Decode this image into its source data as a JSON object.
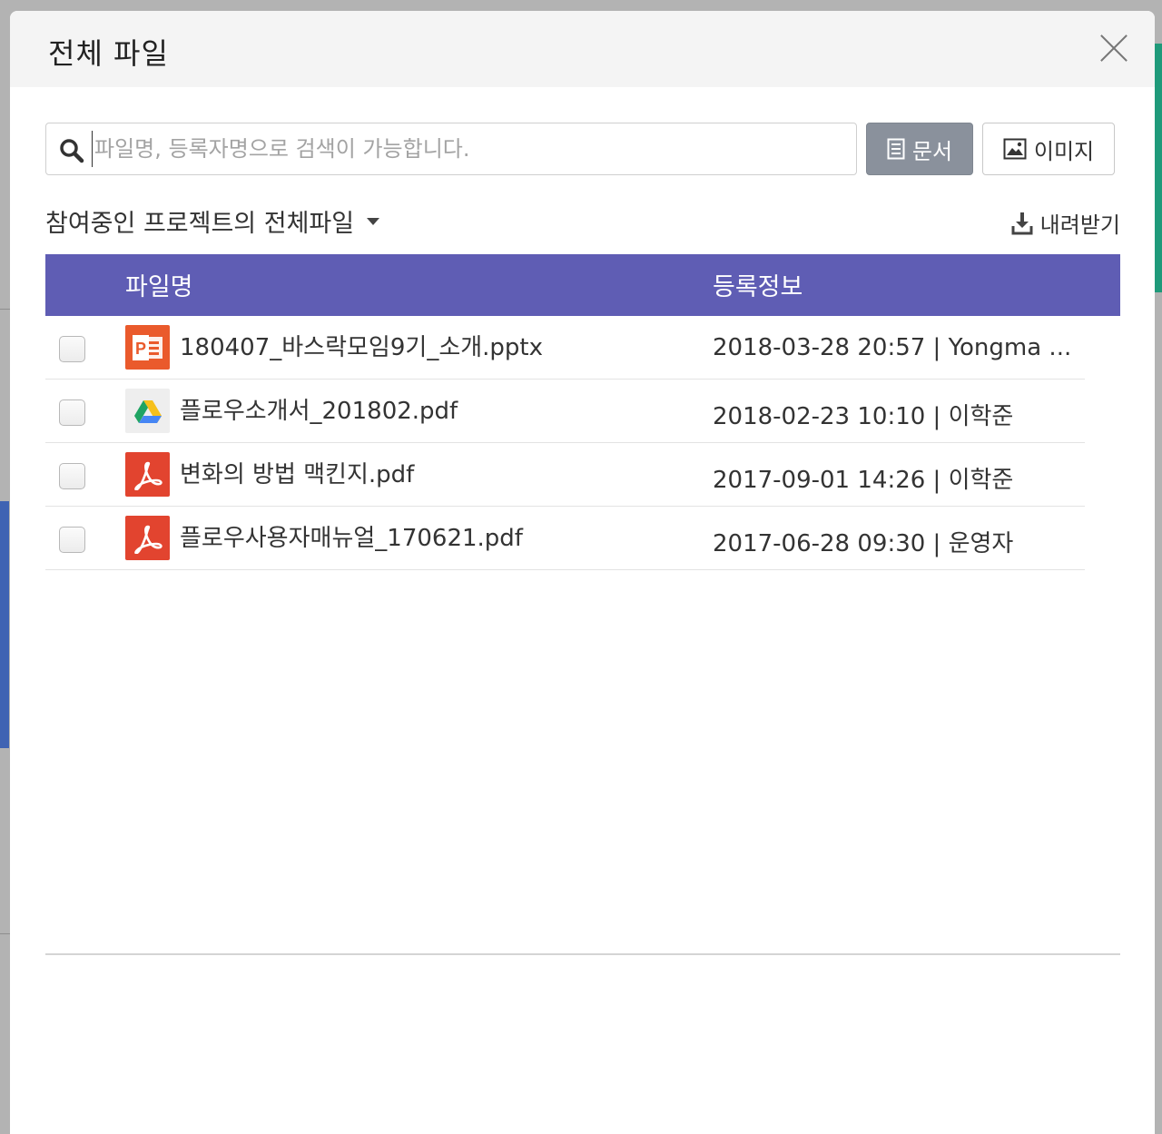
{
  "modal": {
    "title": "전체 파일"
  },
  "search": {
    "placeholder": "파일명, 등록자명으로 검색이 가능합니다.",
    "doc_button": "문서",
    "image_button": "이미지"
  },
  "filter": {
    "label": "참여중인 프로젝트의 전체파일",
    "download_label": "내려받기"
  },
  "table": {
    "headers": {
      "name": "파일명",
      "info": "등록정보"
    },
    "rows": [
      {
        "icon": "powerpoint-icon",
        "icon_color": "#ea5a2c",
        "name": "180407_바스락모임9기_소개.pptx",
        "info": "2018-03-28 20:57 | Yongma ..."
      },
      {
        "icon": "google-drive-icon",
        "icon_color": "#eeeeee",
        "name": "플로우소개서_201802.pdf",
        "info": "2018-02-23 10:10 | 이학준"
      },
      {
        "icon": "acrobat-pdf-icon",
        "icon_color": "#e2442f",
        "name": "변화의 방법 맥킨지.pdf",
        "info": "2017-09-01 14:26 | 이학준"
      },
      {
        "icon": "acrobat-pdf-icon",
        "icon_color": "#e2442f",
        "name": "플로우사용자매뉴얼_170621.pdf",
        "info": "2017-06-28 09:30 | 운영자"
      }
    ]
  },
  "colors": {
    "header_bar": "#5f5db4",
    "doc_button_bg": "#8a919c"
  }
}
